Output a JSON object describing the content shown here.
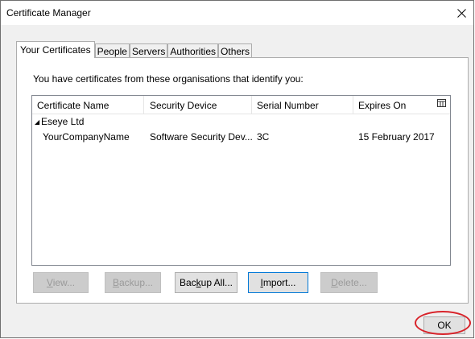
{
  "window": {
    "title": "Certificate Manager",
    "close_glyph": "✕"
  },
  "tabs": [
    {
      "label": "Your Certificates",
      "active": true
    },
    {
      "label": "People",
      "active": false
    },
    {
      "label": "Servers",
      "active": false
    },
    {
      "label": "Authorities",
      "active": false
    },
    {
      "label": "Others",
      "active": false
    }
  ],
  "panel": {
    "intro": "You have certificates from these organisations that identify you:"
  },
  "list": {
    "columns": [
      "Certificate Name",
      "Security Device",
      "Serial Number",
      "Expires On"
    ],
    "column_picker_icon": "column-picker-icon",
    "group": {
      "expander": "◢",
      "name": "Eseye Ltd"
    },
    "rows": [
      {
        "name": "YourCompanyName",
        "device": "Software Security Dev...",
        "serial": "3C",
        "expires": "15 February 2017"
      }
    ]
  },
  "buttons": {
    "view": {
      "mnemonic": "V",
      "rest": "iew..."
    },
    "backup": {
      "mnemonic": "B",
      "rest": "ackup..."
    },
    "backup_all": {
      "pre": "Bac",
      "mnemonic": "k",
      "rest": "up All..."
    },
    "import": {
      "mnemonic": "I",
      "rest": "mport..."
    },
    "delete": {
      "mnemonic": "D",
      "rest": "elete..."
    },
    "ok": "OK"
  },
  "colors": {
    "highlight_ring": "#d8232a",
    "focus_border": "#0078d7"
  }
}
